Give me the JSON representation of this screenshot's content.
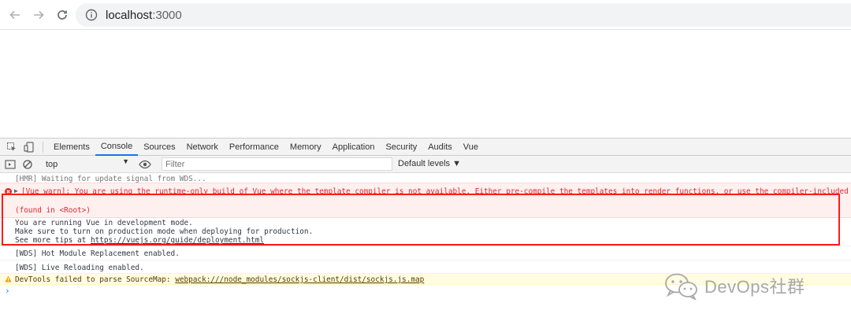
{
  "browser": {
    "url_host": "localhost",
    "url_port": ":3000"
  },
  "devtools": {
    "tabs": [
      {
        "label": "Elements"
      },
      {
        "label": "Console"
      },
      {
        "label": "Sources"
      },
      {
        "label": "Network"
      },
      {
        "label": "Performance"
      },
      {
        "label": "Memory"
      },
      {
        "label": "Application"
      },
      {
        "label": "Security"
      },
      {
        "label": "Audits"
      },
      {
        "label": "Vue"
      }
    ],
    "active_tab": "Console",
    "toolbar": {
      "context": "top",
      "filter_placeholder": "Filter",
      "levels": "Default levels"
    }
  },
  "console": {
    "clipped_line": "[HMR] Waiting for update signal from WDS...",
    "error_main": "[Vue warn]: You are using the runtime-only build of Vue where the template compiler is not available. Either pre-compile the templates into render functions, or use the compiler-included build.",
    "error_found": "(found in <Root>)",
    "info_dev_mode": "You are running Vue in development mode.",
    "info_prod": "Make sure to turn on production mode when deploying for production.",
    "info_tips_prefix": "See more tips at ",
    "info_tips_link": "https://vuejs.org/guide/deployment.html",
    "wds_hot": "[WDS] Hot Module Replacement enabled.",
    "wds_live": "[WDS] Live Reloading enabled.",
    "warn_prefix": "DevTools failed to parse SourceMap: ",
    "warn_link": "webpack:///node_modules/sockjs-client/dist/sockjs.js.map",
    "prompt": "›"
  },
  "watermark": {
    "text": "DevOps社群"
  },
  "colors": {
    "error": "#e0282e",
    "highlight_box": "#ff1a1a",
    "warning_bg": "#fffbe5",
    "active_tab_underline": "#1a73e8"
  }
}
